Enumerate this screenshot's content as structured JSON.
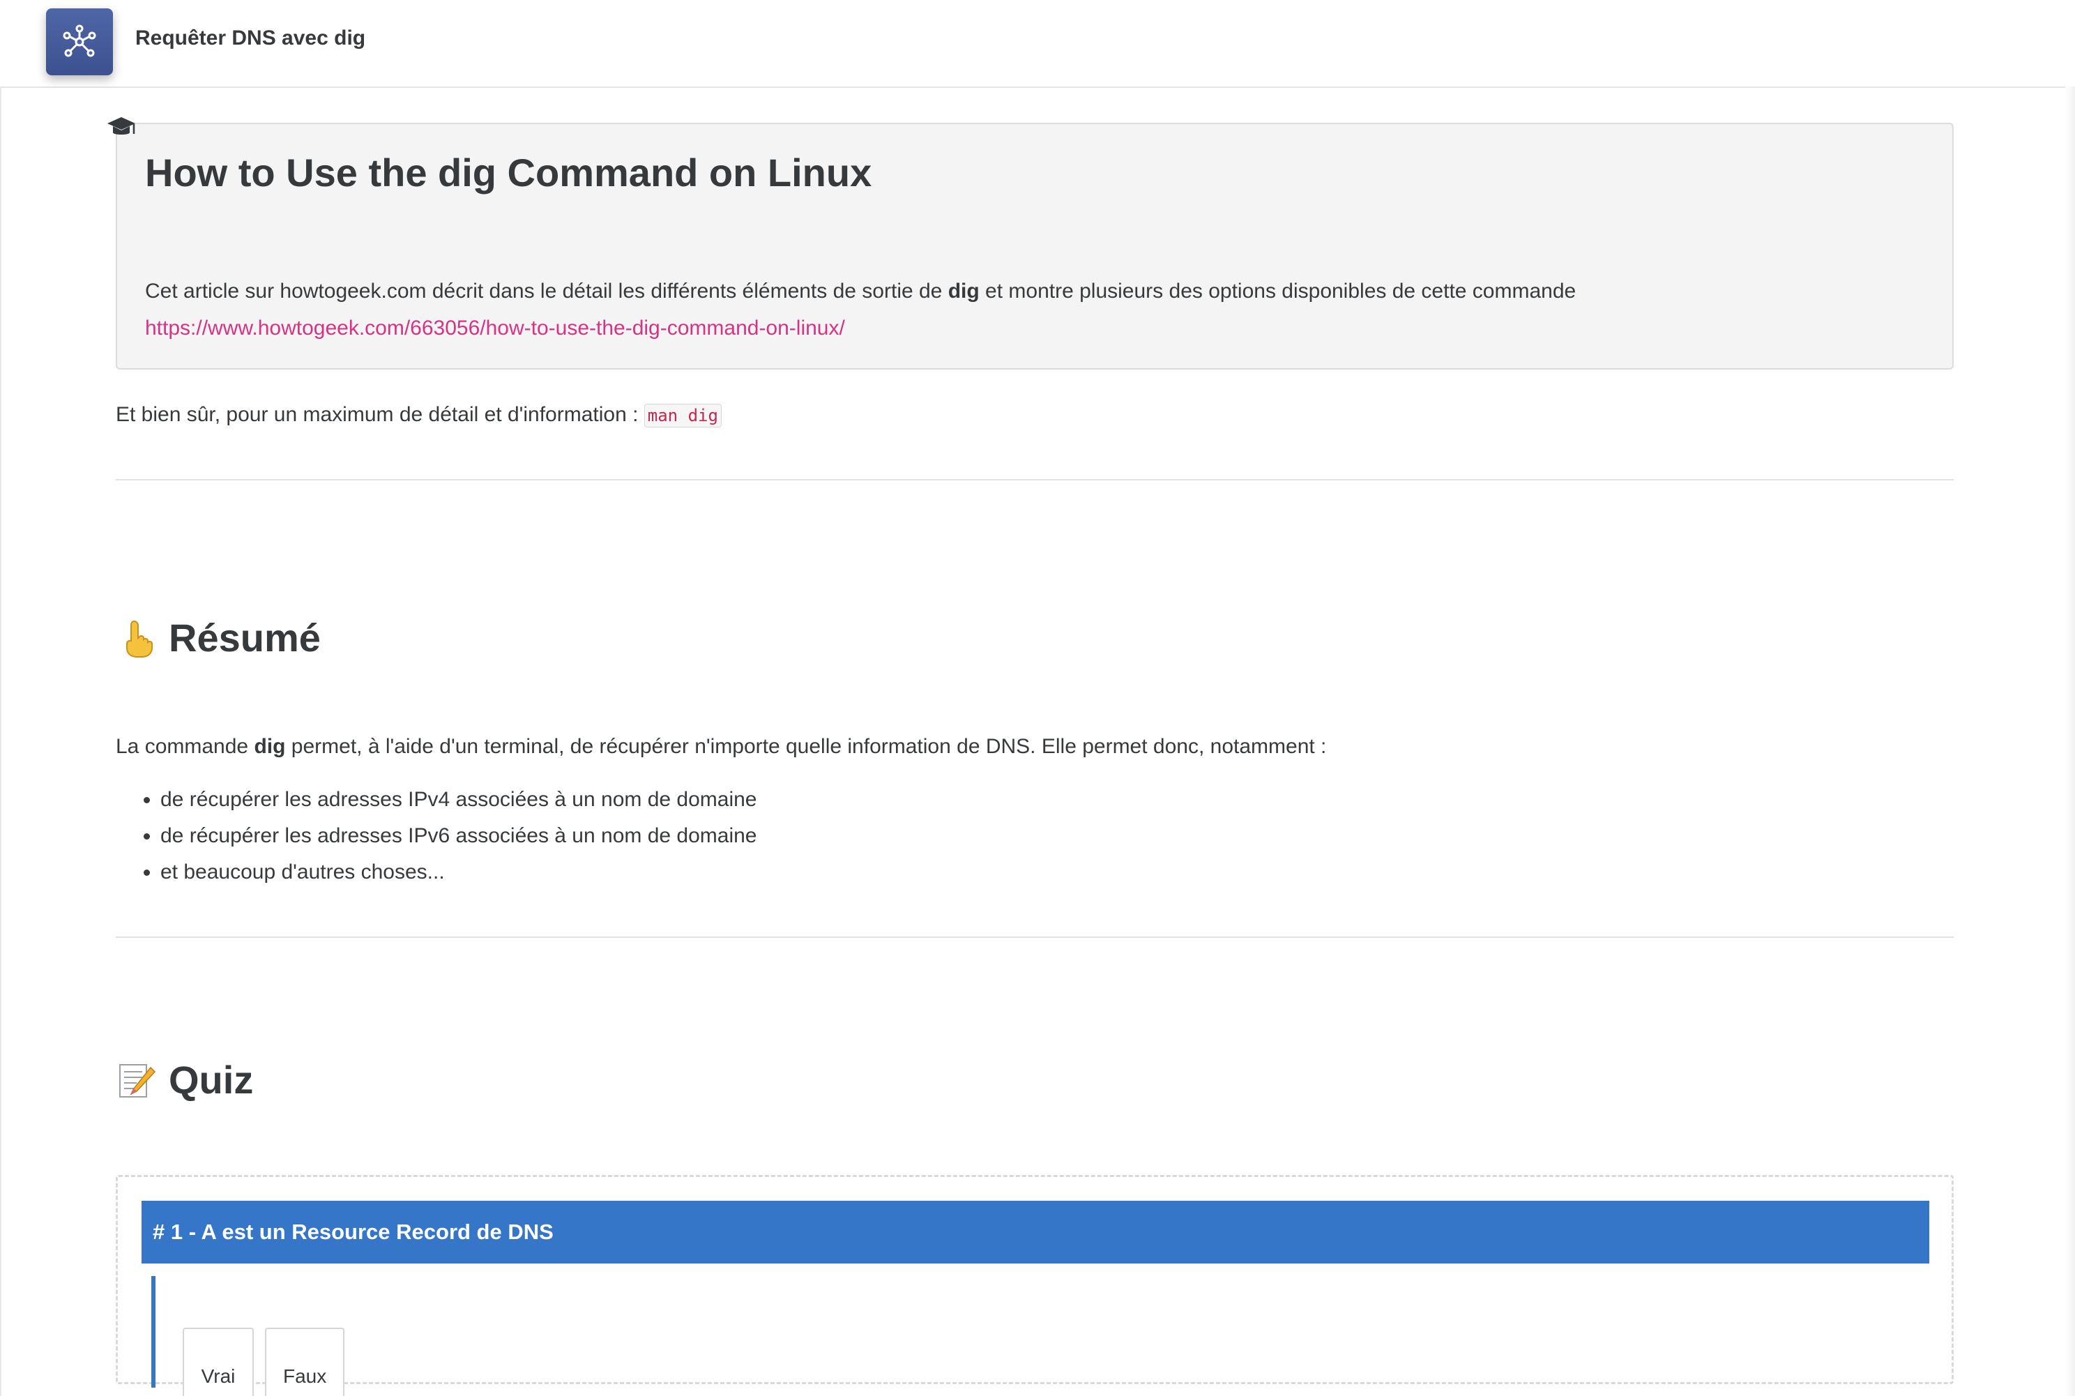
{
  "header": {
    "title": "Requêter DNS avec dig",
    "app_icon": "network-nodes-icon",
    "accent_color": "#4a5f9e"
  },
  "info_box": {
    "icon": "graduation-cap-icon",
    "title": "How to Use the dig Command on Linux",
    "text_before": "Cet article sur howtogeek.com décrit dans le détail les différents éléments de sortie de ",
    "text_bold": "dig",
    "text_after": " et montre plusieurs des options disponibles de cette commande",
    "link": "https://www.howtogeek.com/663056/how-to-use-the-dig-command-on-linux/",
    "link_color": "#d63384"
  },
  "man_line": {
    "text": "Et bien sûr, pour un maximum de détail et d'information : ",
    "code": "man dig"
  },
  "resume": {
    "emoji": "pointing-finger-icon",
    "title": "Résumé",
    "para_before": "La commande ",
    "para_bold": "dig",
    "para_after": " permet, à l'aide d'un terminal, de récupérer n'importe quelle information de DNS. Elle permet donc, notamment :",
    "bullets": [
      "de récupérer les adresses IPv4 associées à un nom de domaine",
      "de récupérer les adresses IPv6 associées à un nom de domaine",
      "et beaucoup d'autres choses..."
    ]
  },
  "quiz": {
    "emoji": "memo-icon",
    "title": "Quiz",
    "question": "# 1 - A est un Resource Record de DNS",
    "header_color": "#3676c9",
    "options": [
      "Vrai",
      "Faux"
    ]
  }
}
